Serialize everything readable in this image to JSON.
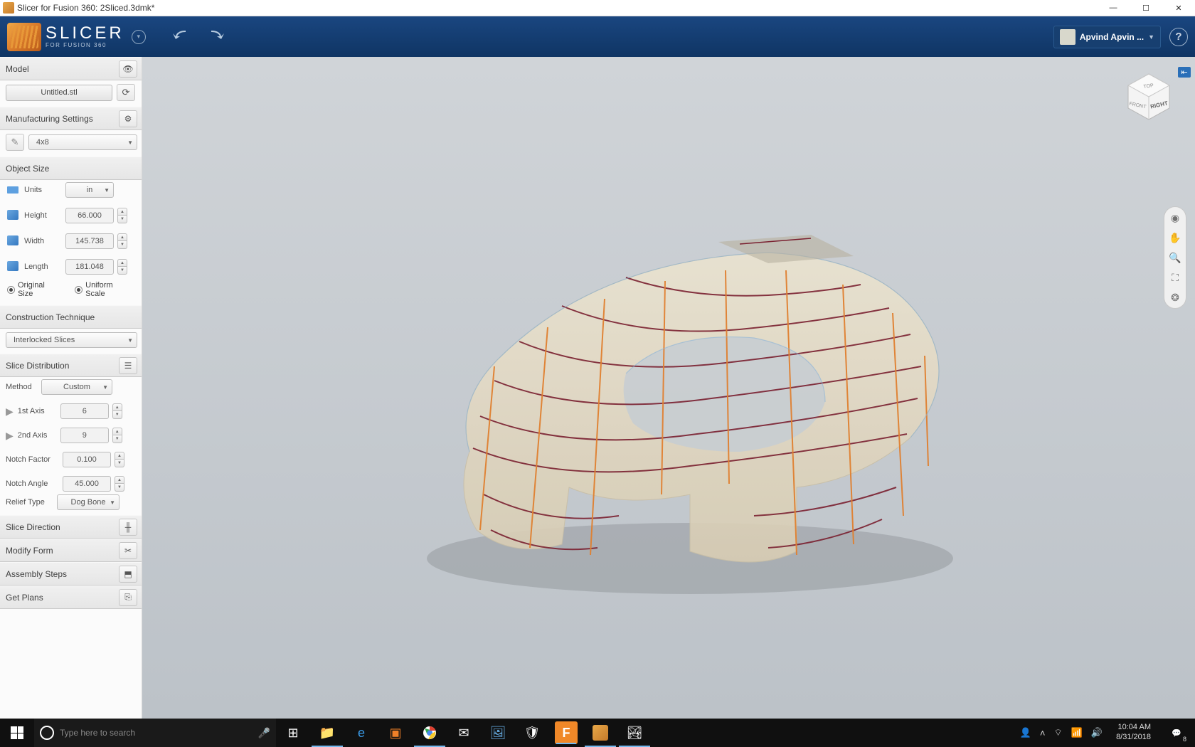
{
  "titlebar": {
    "title": "Slicer for Fusion 360: 2Sliced.3dmk*"
  },
  "header": {
    "app_name": "SLICER",
    "app_sub": "FOR FUSION 360",
    "user_name": "Apvind Apvin ..."
  },
  "sidebar": {
    "model": {
      "header": "Model",
      "file": "Untitled.stl"
    },
    "manufacturing": {
      "header": "Manufacturing Settings",
      "preset": "4x8"
    },
    "object_size": {
      "header": "Object Size",
      "units_label": "Units",
      "units_value": "in",
      "height_label": "Height",
      "height_value": "66.000",
      "width_label": "Width",
      "width_value": "145.738",
      "length_label": "Length",
      "length_value": "181.048",
      "original_size": "Original Size",
      "uniform_scale": "Uniform Scale"
    },
    "construction": {
      "header": "Construction Technique",
      "value": "Interlocked Slices"
    },
    "slice_dist": {
      "header": "Slice Distribution",
      "method_label": "Method",
      "method_value": "Custom",
      "axis1_label": "1st Axis",
      "axis1_value": "6",
      "axis2_label": "2nd Axis",
      "axis2_value": "9",
      "notch_factor_label": "Notch Factor",
      "notch_factor_value": "0.100",
      "notch_angle_label": "Notch Angle",
      "notch_angle_value": "45.000",
      "relief_label": "Relief Type",
      "relief_value": "Dog Bone"
    },
    "slice_direction": "Slice Direction",
    "modify_form": "Modify Form",
    "assembly_steps": "Assembly Steps",
    "get_plans": "Get Plans"
  },
  "viewcube": {
    "top": "TOP",
    "front": "FRONT",
    "right": "RIGHT"
  },
  "taskbar": {
    "search_placeholder": "Type here to search",
    "time": "10:04 AM",
    "date": "8/31/2018",
    "notif_count": "8"
  }
}
